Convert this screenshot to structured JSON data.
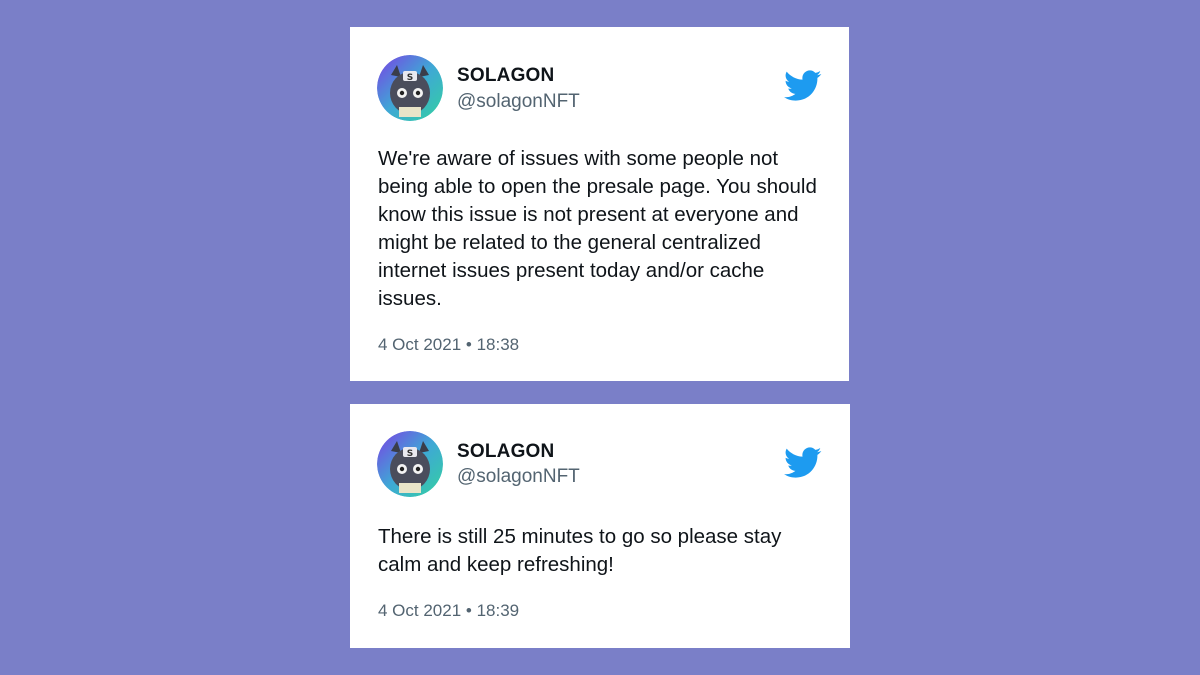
{
  "colors": {
    "background": "#7a7fc8",
    "card": "#ffffff",
    "twitter_blue": "#1d9bf0",
    "text_primary": "#0f1419",
    "text_secondary": "#536471"
  },
  "tweets": [
    {
      "author": {
        "display_name": "SOLAGON",
        "handle": "@solagonNFT",
        "avatar_icon": "dragon-avatar-icon"
      },
      "text": "We're aware of issues with some people not being able to open the presale page. You should know this issue is not present at everyone and might be related to the general centralized internet issues present today and/or cache issues.",
      "timestamp": "4 Oct 2021 • 18:38",
      "brand_icon": "twitter-bird-icon"
    },
    {
      "author": {
        "display_name": "SOLAGON",
        "handle": "@solagonNFT",
        "avatar_icon": "dragon-avatar-icon"
      },
      "text": "There is still 25 minutes to go so please stay calm and keep refreshing!",
      "timestamp": "4 Oct 2021 • 18:39",
      "brand_icon": "twitter-bird-icon"
    }
  ]
}
